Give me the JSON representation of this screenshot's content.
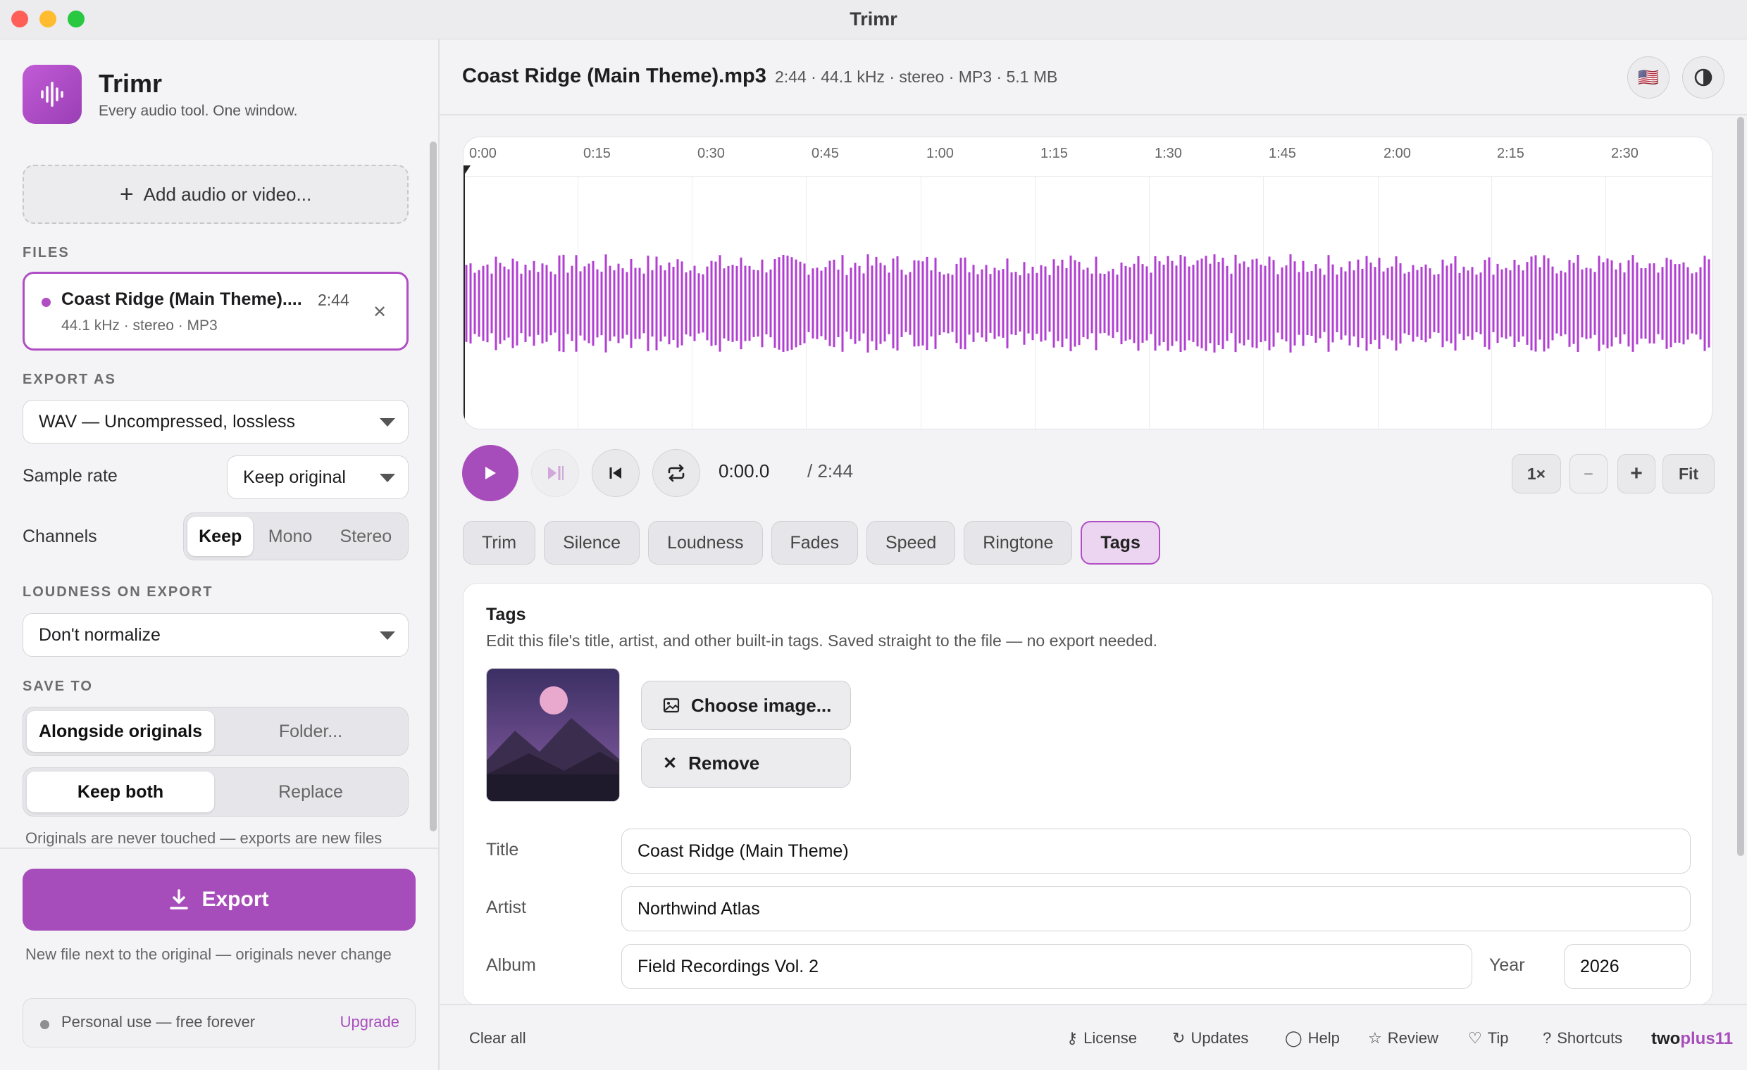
{
  "window": {
    "title": "Trimr"
  },
  "brand": {
    "name": "Trimr",
    "tagline": "Every audio tool. One window."
  },
  "sidebar": {
    "add_label": "Add audio or video...",
    "files_label": "FILES",
    "file": {
      "name": "Coast Ridge (Main Theme)....",
      "duration": "2:44",
      "meta": "44.1 kHz · stereo · MP3"
    },
    "export_as_label": "EXPORT AS",
    "export_format": "WAV — Uncompressed, lossless",
    "sample_rate_label": "Sample rate",
    "sample_rate_value": "Keep original",
    "channels_label": "Channels",
    "channels": [
      "Keep",
      "Mono",
      "Stereo"
    ],
    "loudness_label": "LOUDNESS ON EXPORT",
    "loudness_value": "Don't normalize",
    "save_to_label": "SAVE TO",
    "save_options": [
      "Alongside originals",
      "Folder..."
    ],
    "conflict_options": [
      "Keep both",
      "Replace"
    ],
    "originals_note": "Originals are never touched — exports are new files",
    "export_label": "Export",
    "export_note": "New file next to the original — originals never change",
    "plan_text": "Personal use — free forever",
    "upgrade_label": "Upgrade"
  },
  "header": {
    "file_title": "Coast Ridge (Main Theme).mp3",
    "meta": "2:44 · 44.1 kHz · stereo · MP3 · 5.1 MB",
    "flag": "🇺🇸"
  },
  "timeline": {
    "ticks": [
      "0:00",
      "0:15",
      "0:30",
      "0:45",
      "1:00",
      "1:15",
      "1:30",
      "1:45",
      "2:00",
      "2:15",
      "2:30"
    ]
  },
  "transport": {
    "current_time": "0:00.0",
    "total_time": "/ 2:44"
  },
  "zoom": {
    "level": "1×",
    "minus": "−",
    "plus": "+",
    "fit": "Fit"
  },
  "tabs": [
    "Trim",
    "Silence",
    "Loudness",
    "Fades",
    "Speed",
    "Ringtone",
    "Tags"
  ],
  "tags_panel": {
    "title": "Tags",
    "description": "Edit this file's title, artist, and other built-in tags. Saved straight to the file — no export needed.",
    "choose_image": "Choose image...",
    "remove": "Remove",
    "title_label": "Title",
    "title_value": "Coast Ridge (Main Theme)",
    "artist_label": "Artist",
    "artist_value": "Northwind Atlas",
    "album_label": "Album",
    "album_value": "Field Recordings Vol. 2",
    "year_label": "Year",
    "year_value": "2026"
  },
  "footer": {
    "clear_all": "Clear all",
    "links": [
      "License",
      "Updates",
      "Help",
      "Review",
      "Tip",
      "Shortcuts"
    ],
    "brand_a": "two",
    "brand_b": "plus11"
  },
  "colors": {
    "accent": "#a74dbb",
    "wave": "#b13fd1",
    "close": "#ff5f57",
    "minimize": "#febc2e",
    "zoom": "#28c840"
  },
  "icons": [
    "plus-icon",
    "close-icon",
    "chevron-down-icon",
    "download-icon",
    "play-icon",
    "skip-to-marker-icon",
    "skip-back-icon",
    "loop-icon",
    "image-icon",
    "key-icon",
    "refresh-icon",
    "chat-icon",
    "star-icon",
    "heart-icon",
    "question-icon",
    "contrast-icon"
  ]
}
